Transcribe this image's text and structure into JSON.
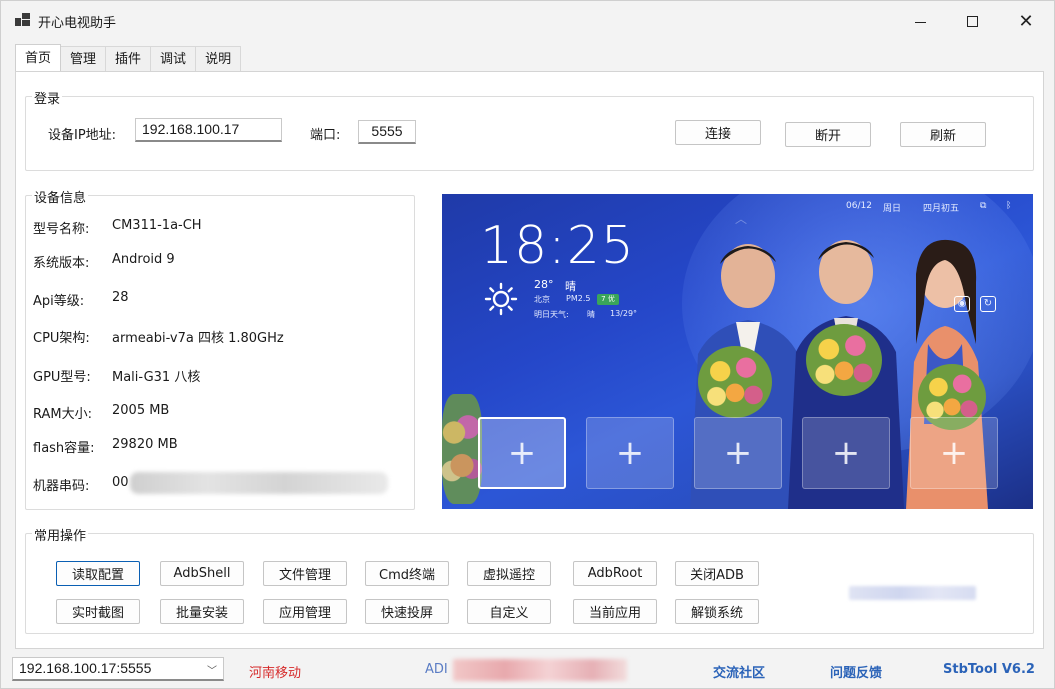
{
  "window": {
    "title": "开心电视助手"
  },
  "tabs": [
    {
      "label": "首页",
      "active": true
    },
    {
      "label": "管理",
      "active": false
    },
    {
      "label": "插件",
      "active": false
    },
    {
      "label": "调试",
      "active": false
    },
    {
      "label": "说明",
      "active": false
    }
  ],
  "login": {
    "group_title": "登录",
    "ip_label": "设备IP地址:",
    "ip_value": "192.168.100.17",
    "port_label": "端口:",
    "port_value": "5555",
    "connect_label": "连接",
    "disconnect_label": "断开",
    "refresh_label": "刷新"
  },
  "device_info": {
    "group_title": "设备信息",
    "rows": [
      {
        "label": "型号名称:",
        "value": "CM311-1a-CH"
      },
      {
        "label": "系统版本:",
        "value": "Android 9"
      },
      {
        "label": "Api等级:",
        "value": "28"
      },
      {
        "label": "CPU架构:",
        "value": "armeabi-v7a 四核 1.80GHz"
      },
      {
        "label": "GPU型号:",
        "value": "Mali-G31 八核"
      },
      {
        "label": "RAM大小:",
        "value": "2005 MB"
      },
      {
        "label": "flash容量:",
        "value": "29820 MB"
      },
      {
        "label": "机器串码:",
        "value": "00"
      }
    ]
  },
  "tv_screen": {
    "date": "06/12",
    "weekday": "周日",
    "lunar": "四月初五",
    "time": "18:25",
    "temperature": "28°",
    "weather": "晴",
    "city": "北京",
    "pm_label": "PM2.5",
    "pm_badge": "7 优",
    "tomorrow_label": "明日天气:",
    "tomorrow_weather": "晴",
    "tomorrow_range": "13/29°",
    "tile_symbol": "+"
  },
  "common_ops": {
    "group_title": "常用操作",
    "row1": [
      "读取配置",
      "AdbShell",
      "文件管理",
      "Cmd终端",
      "虚拟遥控",
      "AdbRoot",
      "关闭ADB"
    ],
    "row2": [
      "实时截图",
      "批量安装",
      "应用管理",
      "快速投屏",
      "自定义",
      "当前应用",
      "解锁系统"
    ]
  },
  "statusbar": {
    "connection": "192.168.100.17:5555",
    "isp": "河南移动",
    "adb_prefix": "ADI",
    "community": "交流社区",
    "feedback": "问题反馈",
    "version": "StbTool V6.2"
  }
}
